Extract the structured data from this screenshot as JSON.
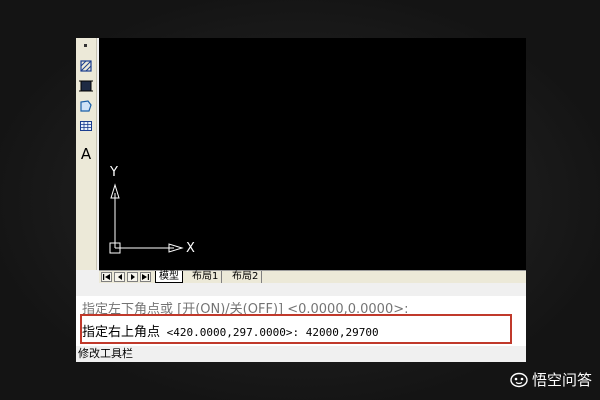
{
  "toolbar": {
    "icons": [
      "hatch-icon",
      "gradient-icon",
      "region-icon",
      "table-icon",
      "multiline-text-icon"
    ],
    "text_icon_glyph": "A"
  },
  "canvas": {
    "background": "#000000",
    "axis_x_label": "X",
    "axis_y_label": "Y"
  },
  "layout_tabs": {
    "model": "模型",
    "layout1": "布局1",
    "layout2": "布局2"
  },
  "command": {
    "prev_line": "指定左下角点或 [开(ON)/关(OFF)] <0.0000,0.0000>:",
    "prompt": "指定右上角点",
    "default_value": "<420.0000,297.0000>:",
    "input": "42000,29700",
    "highlight_color": "#c0392b"
  },
  "status": {
    "label": "修改工具栏"
  },
  "watermark": {
    "text": "悟空问答"
  }
}
